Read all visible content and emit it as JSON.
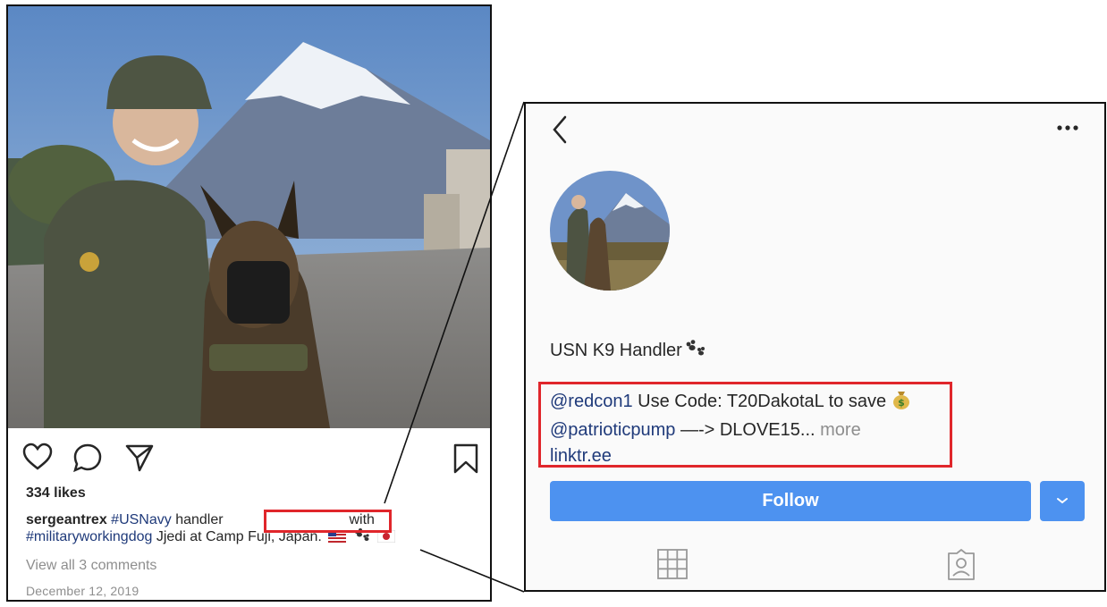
{
  "post": {
    "likes": "334 likes",
    "caption": {
      "username": "sergeantrex",
      "hashtag_navy": "#USNavy",
      "text_handler": "handler",
      "text_with": "with",
      "hashtag_mwd": "#militaryworkingdog",
      "text_rest": "Jjedi at Camp Fuji, Japan."
    },
    "view_comments": "View all 3 comments",
    "date": "December 12, 2019",
    "icons": [
      "heart-icon",
      "comment-icon",
      "share-icon",
      "bookmark-icon"
    ]
  },
  "profile": {
    "bio_name": "USN K9 Handler",
    "bio_line1": {
      "mention": "@redcon1",
      "text": "Use Code: T20DakotaL to save"
    },
    "bio_line2": {
      "mention": "@patrioticpump",
      "text": "—-> DLOVE15...",
      "more": "more"
    },
    "bio_link": "linktr.ee",
    "follow_label": "Follow",
    "icons": [
      "back-icon",
      "more-icon",
      "grid-icon",
      "tagged-icon",
      "chevron-down-icon"
    ]
  },
  "colors": {
    "follow_blue": "#4d92f0",
    "link_blue": "#1f3a7a",
    "highlight_red": "#e0262b",
    "muted_gray": "#8e8e8e"
  }
}
